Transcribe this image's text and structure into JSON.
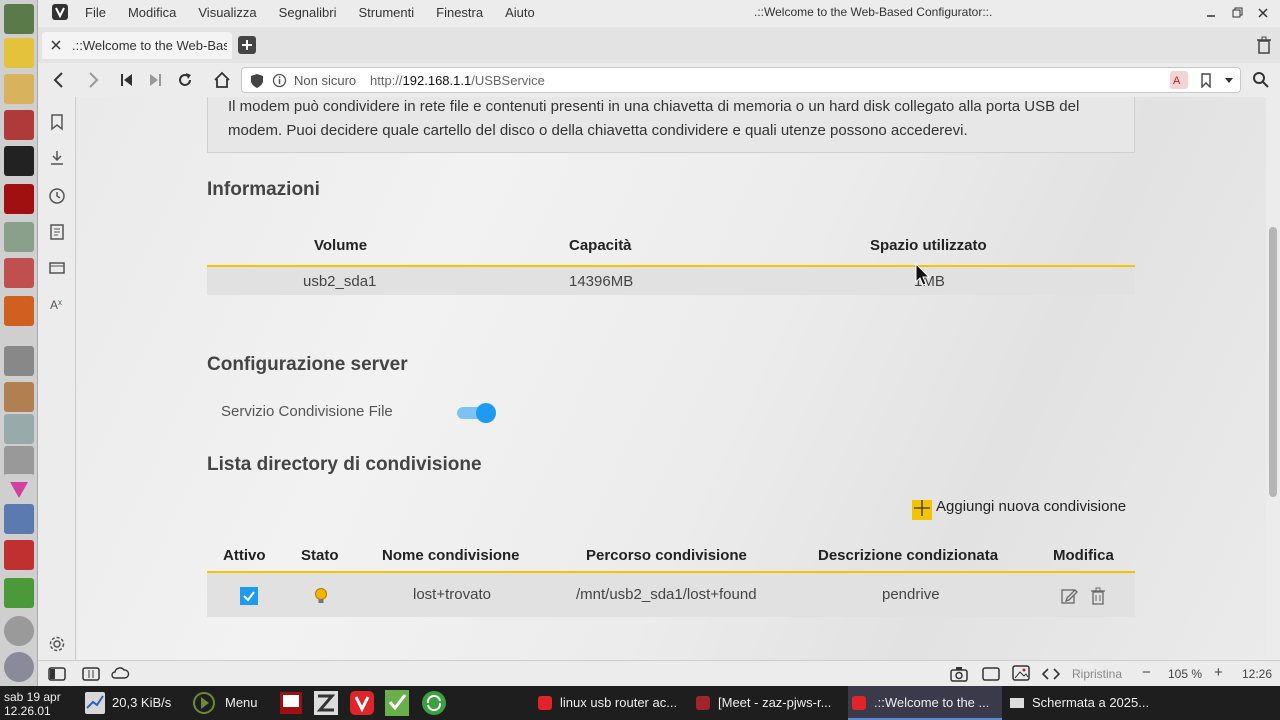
{
  "titlebar": {
    "menu": [
      "File",
      "Modifica",
      "Visualizza",
      "Segnalibri",
      "Strumenti",
      "Finestra",
      "Aiuto"
    ],
    "window_title": ".::Welcome to the Web-Based Configurator::."
  },
  "tab": {
    "title": ".::Welcome to the Web-Based Configurator::."
  },
  "address": {
    "security": "Non sicuro",
    "url_prefix": "http://",
    "url_host": "192.168.1.1",
    "url_path": "/USBService"
  },
  "page": {
    "intro": "Il modem può condividere in rete file e contenuti presenti in una chiavetta di memoria o un hard disk collegato alla porta USB del modem. Puoi decidere quale cartello del disco o della chiavetta condividere e quali utenze possono accederevi.",
    "info_title": "Informazioni",
    "info_table": {
      "headers": [
        "Volume",
        "Capacità",
        "Spazio utilizzato"
      ],
      "rows": [
        [
          "usb2_sda1",
          "14396MB",
          "1MB"
        ]
      ]
    },
    "server_title": "Configurazione server",
    "file_sharing_label": "Servizio Condivisione File",
    "file_sharing_on": true,
    "share_list_title": "Lista directory di condivisione",
    "add_share_label": "Aggiungi nuova condivisione",
    "share_table": {
      "headers": [
        "Attivo",
        "Stato",
        "Nome condivisione",
        "Percorso condivisione",
        "Descrizione condizionata",
        "Modifica"
      ],
      "rows": [
        {
          "active": true,
          "name": "lost+trovato",
          "path": "/mnt/usb2_sda1/lost+found",
          "description": "pendrive"
        }
      ]
    },
    "accent_color": "#f5c400",
    "toggle_color": "#1e9bf0"
  },
  "statusbar": {
    "reset": "Ripristina",
    "zoom": "105 %",
    "time": "12:26"
  },
  "taskbar": {
    "date": "sab 19 apr",
    "time": "12.26.01",
    "net_speed": "20,3 KiB/s",
    "menu": "Menu",
    "windows": [
      "linux usb router ac...",
      "[Meet - zaz-pjws-r...",
      ".::Welcome to the ...",
      "Schermata a 2025..."
    ]
  }
}
